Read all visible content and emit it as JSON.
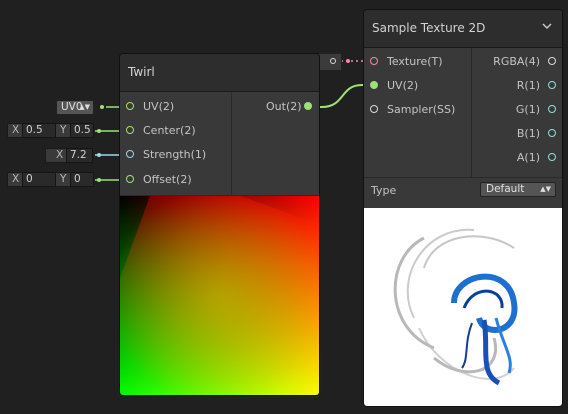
{
  "twirl": {
    "title": "Twirl",
    "inputs": [
      "UV(2)",
      "Center(2)",
      "Strength(1)",
      "Offset(2)"
    ],
    "output": "Out(2)"
  },
  "sample_texture": {
    "title": "Sample Texture 2D",
    "inputs": [
      "Texture(T)",
      "UV(2)",
      "Sampler(SS)"
    ],
    "outputs": [
      "RGBA(4)",
      "R(1)",
      "G(1)",
      "B(1)",
      "A(1)"
    ],
    "type_label": "Type",
    "type_value": "Default"
  },
  "uv_channel": "UV0",
  "center": {
    "x_label": "X",
    "x": "0.5",
    "y_label": "Y",
    "y": "0.5"
  },
  "strength": {
    "x_label": "X",
    "x": "7.2"
  },
  "offset": {
    "x_label": "X",
    "x": "0",
    "y_label": "Y",
    "y": "0"
  },
  "colors": {
    "vector_port": "#9ee07a",
    "float_port": "#9fd7e8",
    "texture_port": "#f18aa0",
    "node_body": "#393939",
    "node_header": "#2d2d2d",
    "background": "#202020"
  }
}
